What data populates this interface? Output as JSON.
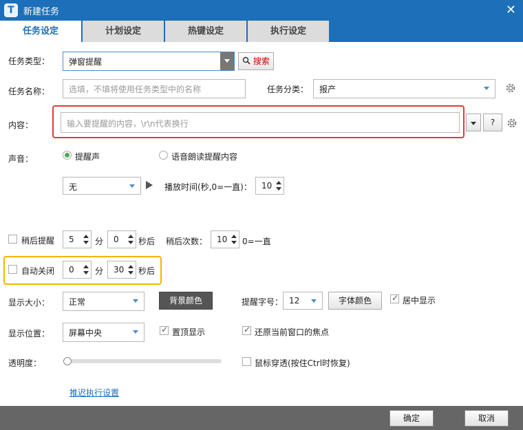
{
  "window": {
    "title": "新建任务",
    "logo": "T"
  },
  "tabs": [
    {
      "label": "任务设定",
      "active": true
    },
    {
      "label": "计划设定",
      "active": false
    },
    {
      "label": "热键设定",
      "active": false
    },
    {
      "label": "执行设定",
      "active": false
    }
  ],
  "task_type": {
    "label": "任务类型：",
    "value": "弹窗提醒",
    "search_label": "搜索"
  },
  "task_name": {
    "label": "任务名称：",
    "placeholder": "选填，不填将使用任务类型中的名称"
  },
  "task_category": {
    "label": "任务分类：",
    "value": "报产"
  },
  "content": {
    "label": "内容：",
    "placeholder": "输入要提醒的内容，\\r\\n代表换行",
    "help_label": "?"
  },
  "sound": {
    "label": "声音：",
    "option1": "提醒声",
    "option2": "语音朗读提醒内容",
    "selected": "option1",
    "sound_value": "无",
    "play_time_label": "播放时间(秒,0=一直)：",
    "play_time_value": "10"
  },
  "snooze": {
    "label": "稍后提醒",
    "checked": false,
    "minutes": "5",
    "min_unit": "分",
    "seconds": "0",
    "sec_unit": "秒后",
    "count_label": "稍后次数：",
    "count_value": "10",
    "count_hint": "0=一直"
  },
  "auto_close": {
    "label": "自动关闭",
    "checked": false,
    "minutes": "0",
    "min_unit": "分",
    "seconds": "30",
    "sec_unit": "秒后"
  },
  "display_size": {
    "label": "显示大小：",
    "value": "正常",
    "bg_color_button": "背景颜色"
  },
  "font_size": {
    "label": "提醒字号：",
    "value": "12",
    "font_color_button": "字体颜色",
    "center_label": "居中显示",
    "center_checked": true
  },
  "display_position": {
    "label": "显示位置：",
    "value": "屏幕中央",
    "top_label": "置顶显示",
    "top_checked": true,
    "restore_focus_label": "还原当前窗口的焦点",
    "restore_focus_checked": true
  },
  "opacity": {
    "label": "透明度：",
    "level": 0,
    "mouse_through_label": "鼠标穿透(按住Ctrl时恢复)",
    "mouse_through_checked": false
  },
  "delay_link": "推迟执行设置",
  "footer": {
    "ok": "确定",
    "cancel": "取消"
  },
  "colors": {
    "titlebar": "#1c6fb8",
    "footer": "#666666",
    "highlight_red": "#e53935",
    "highlight_yellow": "#f5b301"
  }
}
